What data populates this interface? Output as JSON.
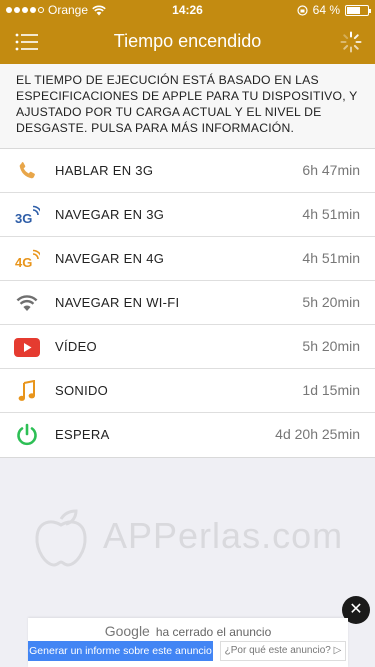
{
  "status_bar": {
    "carrier": "Orange",
    "time": "14:26",
    "battery_text": "64 %",
    "battery_level_percent": 64
  },
  "nav": {
    "title": "Tiempo encendido"
  },
  "info_text": "EL TIEMPO DE EJECUCIÓN ESTÁ BASADO EN LAS ESPECIFICACIONES DE APPLE PARA TU DISPOSITIVO, Y AJUSTADO POR TU CARGA ACTUAL Y EL NIVEL DE DESGASTE. PULSA PARA MÁS INFORMACIÓN.",
  "rows": [
    {
      "icon": "phone-icon",
      "label": "HABLAR EN 3G",
      "value": "6h 47min"
    },
    {
      "icon": "3g-icon",
      "label": "NAVEGAR EN 3G",
      "value": "4h 51min"
    },
    {
      "icon": "4g-icon",
      "label": "NAVEGAR EN 4G",
      "value": "4h 51min"
    },
    {
      "icon": "wifi-icon",
      "label": "NAVEGAR EN WI-FI",
      "value": "5h 20min"
    },
    {
      "icon": "video-icon",
      "label": "VÍDEO",
      "value": "5h 20min"
    },
    {
      "icon": "music-icon",
      "label": "SONIDO",
      "value": "1d 15min"
    },
    {
      "icon": "power-icon",
      "label": "ESPERA",
      "value": "4d 20h 25min"
    }
  ],
  "watermark": "APPerlas.com",
  "ad": {
    "brand": "Google",
    "closed_text": "ha cerrado el anuncio",
    "report_button": "Generar un informe sobre este anuncio",
    "why_button": "¿Por qué este anuncio?",
    "close_symbol": "✕"
  },
  "colors": {
    "header": "#c38b11",
    "icon_orange": "#e8951c",
    "icon_blue": "#2f5ea8",
    "icon_gray": "#6f6f6f",
    "icon_red": "#e53b30",
    "icon_green": "#2dbf55"
  }
}
